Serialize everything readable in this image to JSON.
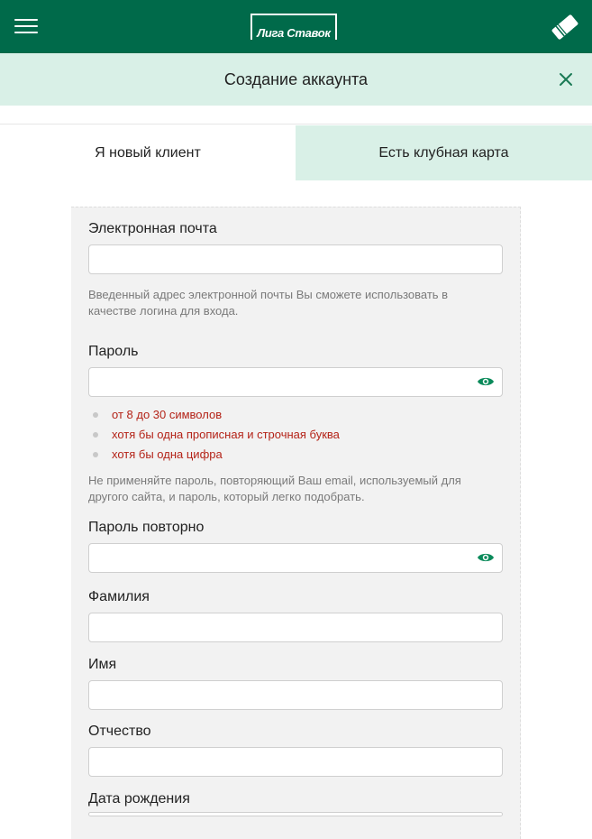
{
  "topbar": {
    "logo_text": "Лига Ставок",
    "menu_icon": "hamburger-menu-icon",
    "ticket_icon": "ticket-icon",
    "brand_color": "#006a4a"
  },
  "header": {
    "title": "Создание аккаунта",
    "close_icon": "close-icon",
    "background": "#d9f0e7"
  },
  "tabs": [
    {
      "label": "Я новый клиент",
      "active": true
    },
    {
      "label": "Есть клубная карта",
      "active": false
    }
  ],
  "form": {
    "email": {
      "label": "Электронная почта",
      "value": "",
      "hint": "Введенный адрес электронной почты Вы сможете использовать в качестве логина для входа."
    },
    "password": {
      "label": "Пароль",
      "value": "",
      "eye_icon": "eye-icon",
      "requirements": [
        "от 8 до 30 символов",
        "хотя бы одна прописная и строчная буква",
        "хотя бы одна цифра"
      ],
      "hint": "Не применяйте пароль, повторяющий Ваш email, используемый для другого сайта, и пароль, который легко подобрать."
    },
    "password_repeat": {
      "label": "Пароль повторно",
      "value": "",
      "eye_icon": "eye-icon"
    },
    "last_name": {
      "label": "Фамилия",
      "value": ""
    },
    "first_name": {
      "label": "Имя",
      "value": ""
    },
    "middle_name": {
      "label": "Отчество",
      "value": ""
    },
    "birth_date": {
      "label": "Дата рождения",
      "value": ""
    }
  },
  "colors": {
    "requirement_text": "#b42318",
    "eye_icon": "#0a8a5a"
  }
}
